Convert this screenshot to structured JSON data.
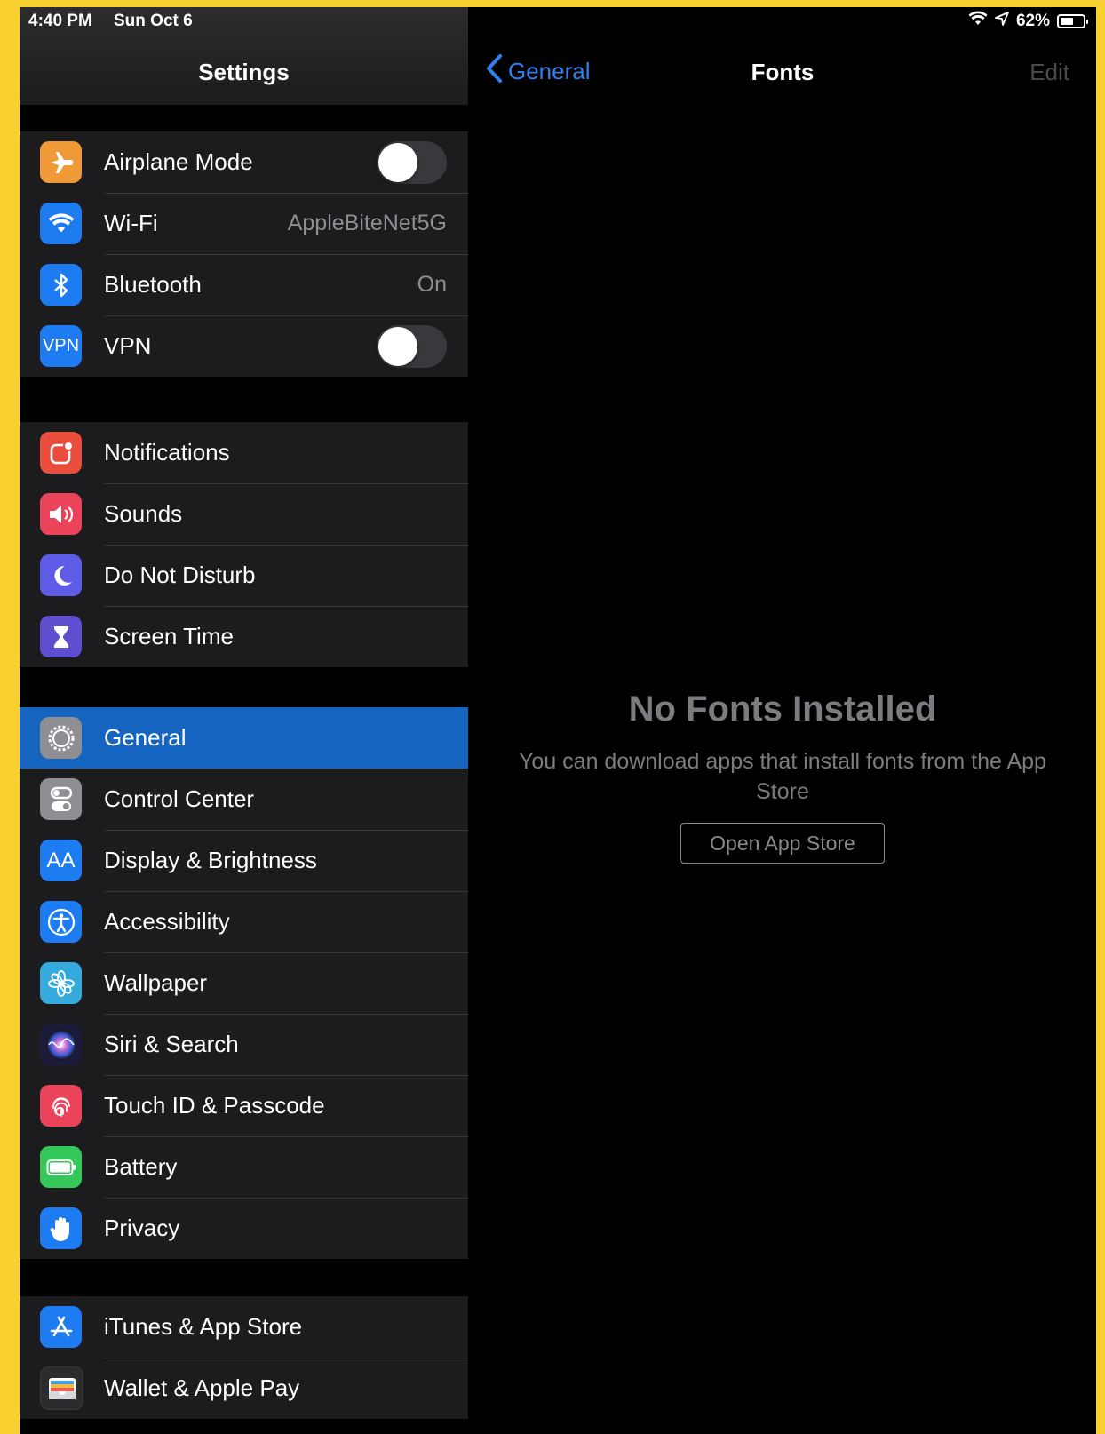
{
  "status_bar": {
    "time": "4:40 PM",
    "date": "Sun Oct 6",
    "battery": "62%",
    "battery_level": 0.62
  },
  "sidebar": {
    "title": "Settings",
    "groups": [
      [
        {
          "label": "Airplane Mode",
          "icon": "airplane-icon",
          "color": "#F09A37",
          "control": "toggle",
          "on": false
        },
        {
          "label": "Wi-Fi",
          "icon": "wifi-icon",
          "color": "#1E7CF2",
          "value": "AppleBiteNet5G"
        },
        {
          "label": "Bluetooth",
          "icon": "bluetooth-icon",
          "color": "#1E7CF2",
          "value": "On"
        },
        {
          "label": "VPN",
          "icon": "vpn-icon",
          "color": "#1E7CF2",
          "control": "toggle",
          "on": false,
          "icon_text": "VPN"
        }
      ],
      [
        {
          "label": "Notifications",
          "icon": "notifications-icon",
          "color": "#EB4D3D"
        },
        {
          "label": "Sounds",
          "icon": "sounds-icon",
          "color": "#EB445A"
        },
        {
          "label": "Do Not Disturb",
          "icon": "moon-icon",
          "color": "#5E5CE6"
        },
        {
          "label": "Screen Time",
          "icon": "hourglass-icon",
          "color": "#5E4FD1"
        }
      ],
      [
        {
          "label": "General",
          "icon": "gear-icon",
          "color": "#8E8E93",
          "selected": true
        },
        {
          "label": "Control Center",
          "icon": "control-center-icon",
          "color": "#8E8E93"
        },
        {
          "label": "Display & Brightness",
          "icon": "display-icon",
          "color": "#1E7CF2",
          "icon_text": "AA"
        },
        {
          "label": "Accessibility",
          "icon": "accessibility-icon",
          "color": "#1E7CF2"
        },
        {
          "label": "Wallpaper",
          "icon": "wallpaper-icon",
          "color": "#35AADC"
        },
        {
          "label": "Siri & Search",
          "icon": "siri-icon",
          "color": "#1c1c3a"
        },
        {
          "label": "Touch ID & Passcode",
          "icon": "fingerprint-icon",
          "color": "#EB445A"
        },
        {
          "label": "Battery",
          "icon": "battery-icon",
          "color": "#34C759"
        },
        {
          "label": "Privacy",
          "icon": "hand-icon",
          "color": "#1E7CF2"
        }
      ],
      [
        {
          "label": "iTunes & App Store",
          "icon": "app-store-icon",
          "color": "#1E7CF2"
        },
        {
          "label": "Wallet & Apple Pay",
          "icon": "wallet-icon",
          "color": "#2c2c2e"
        }
      ]
    ]
  },
  "detail": {
    "back_label": "General",
    "title": "Fonts",
    "edit_label": "Edit",
    "empty_title": "No Fonts Installed",
    "empty_text": "You can download apps that install fonts from the App Store",
    "button_label": "Open App Store"
  },
  "colors": {
    "accent": "#2F80ED",
    "selected_row": "#1464C0"
  }
}
